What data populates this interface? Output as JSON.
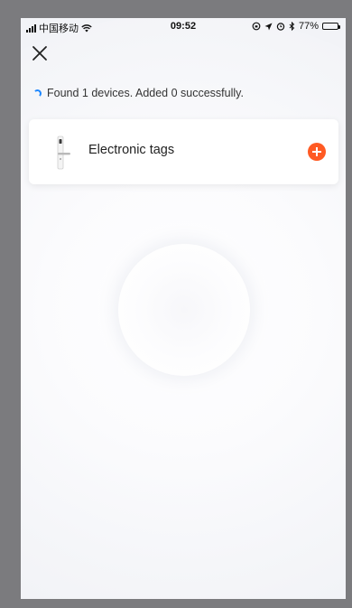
{
  "status_bar": {
    "carrier": "中国移动",
    "time": "09:52",
    "battery": "77%",
    "battery_level": 0.77
  },
  "scan": {
    "status_text": "Found 1 devices. Added 0 successfully."
  },
  "devices": [
    {
      "name": "Electronic tags"
    }
  ],
  "colors": {
    "accent": "#ff5a23",
    "spinner": "#1e88ff",
    "background": "#f2f3f7"
  }
}
